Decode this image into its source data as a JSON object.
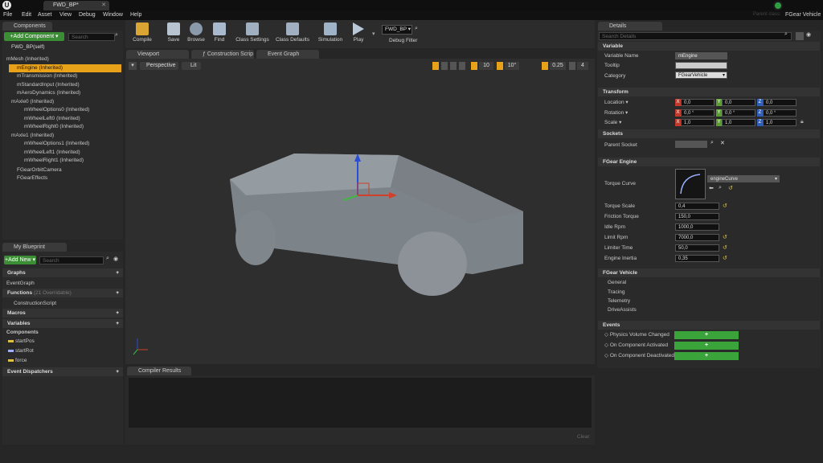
{
  "titlebar": {
    "tab": "FWD_BP*",
    "logo": "U",
    "parent_class": "Parent class:",
    "vehicle_class": "FGear Vehicle"
  },
  "menu": [
    "File",
    "Edit",
    "Asset",
    "View",
    "Debug",
    "Window",
    "Help"
  ],
  "components": {
    "tab": "Components",
    "add_button": "+Add Component ▾",
    "search_placeholder": "Search",
    "self": "FWD_BP(self)",
    "items": [
      "mMesh (Inherited)",
      "mEngine (Inherited)",
      "mTransmission (Inherited)",
      "mStandardInput (Inherited)",
      "mAeroDynamics (Inherited)",
      "mAxle0 (Inherited)",
      "mWheelOptions0 (Inherited)",
      "mWheelLeft0 (Inherited)",
      "mWheelRight0 (Inherited)",
      "mAxle1 (Inherited)",
      "mWheelOptions1 (Inherited)",
      "mWheelLeft1 (Inherited)",
      "mWheelRight1 (Inherited)",
      "FGearOrbitCamera",
      "FGearEffects"
    ]
  },
  "toolbar": {
    "compile": "Compile",
    "save": "Save",
    "browse": "Browse",
    "find": "Find",
    "class_settings": "Class Settings",
    "class_defaults": "Class Defaults",
    "simulation": "Simulation",
    "play": "Play",
    "debug_filter_value": "FWD_BP",
    "debug_filter": "Debug Filter"
  },
  "tabs": {
    "viewport": "Viewport",
    "construction": "Construction Scrip",
    "event_graph": "Event Graph"
  },
  "viewport": {
    "perspective": "Perspective",
    "lit": "Lit",
    "grid": "10",
    "angle": "10°",
    "scale": "0.25",
    "cam": "4"
  },
  "blueprint": {
    "tab": "My Blueprint",
    "add_new": "+Add New ▾",
    "search_placeholder": "Search",
    "graphs": "Graphs",
    "event_graph": "EventGraph",
    "functions": "Functions",
    "overridable": "(21 Overridable)",
    "construction": "ConstructionScript",
    "macros": "Macros",
    "variables": "Variables",
    "components": "Components",
    "vars": [
      "startPos",
      "startRot",
      "force"
    ],
    "dispatchers": "Event Dispatchers"
  },
  "compiler": {
    "tab": "Compiler Results",
    "clear": "Clear"
  },
  "details": {
    "tab": "Details",
    "search_placeholder": "Search Details",
    "variable": "Variable",
    "var_name_label": "Variable Name",
    "var_name": "mEngine",
    "tooltip_label": "Tooltip",
    "category_label": "Category",
    "category": "FGearVehicle",
    "transform": "Transform",
    "location": "Location ▾",
    "rotation": "Rotation ▾",
    "scale": "Scale ▾",
    "loc": [
      "0,0",
      "0,0",
      "0,0"
    ],
    "rot": [
      "0,0 °",
      "0,0 °",
      "0,0 °"
    ],
    "scl": [
      "1,0",
      "1,0",
      "1,0"
    ],
    "sockets": "Sockets",
    "parent_socket": "Parent Socket",
    "fgear_engine": "FGear Engine",
    "torque_curve": "Torque Curve",
    "curve_name": "engineCurve",
    "engine_props": [
      {
        "label": "Torque Scale",
        "value": "0,4"
      },
      {
        "label": "Friction Torque",
        "value": "150,0"
      },
      {
        "label": "Idle Rpm",
        "value": "1000,0"
      },
      {
        "label": "Limit Rpm",
        "value": "7000,0"
      },
      {
        "label": "Limiter Time",
        "value": "50,0"
      },
      {
        "label": "Engine Inertia",
        "value": "0,35"
      }
    ],
    "fgear_vehicle": "FGear Vehicle",
    "vehicle_items": [
      "General",
      "Tracing",
      "Telemetry",
      "DriveAssists"
    ],
    "events": "Events",
    "event_items": [
      "Physics Volume Changed",
      "On Component Activated",
      "On Component Deactivated"
    ],
    "plus": "+"
  }
}
